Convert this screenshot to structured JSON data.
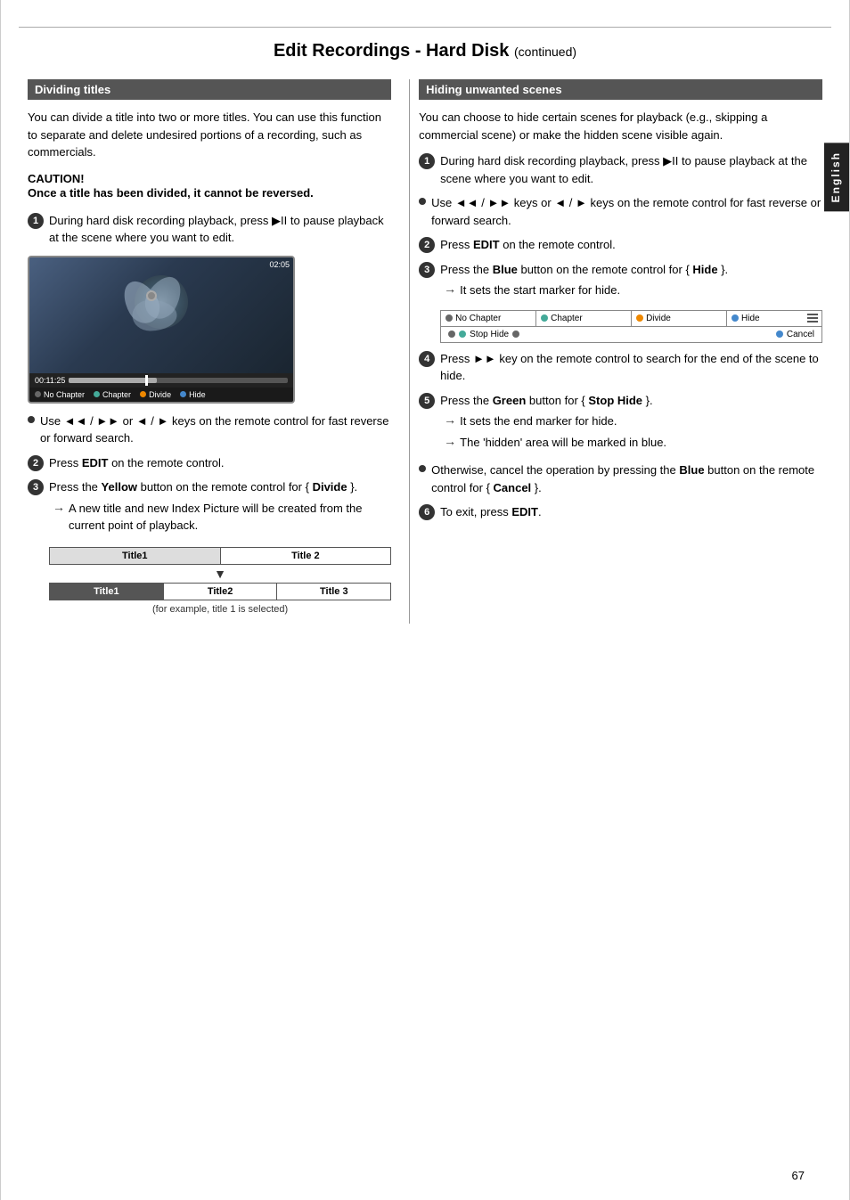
{
  "page": {
    "title": "Edit Recordings - Hard Disk",
    "title_suffix": "(continued)",
    "page_number": "67",
    "side_tab": "English"
  },
  "left_section": {
    "header": "Dividing titles",
    "intro": "You can divide a title into two or more titles. You can use this function to separate and delete undesired portions of a recording, such as commercials.",
    "caution_title": "CAUTION!",
    "caution_body": "Once a title has been divided, it cannot be reversed.",
    "step1": "During hard disk recording playback, press ▶II to pause playback at the scene where you want to edit.",
    "tv_time": "00:11:25",
    "tv_end_time": "02:05",
    "legend_items": [
      {
        "label": "No Chapter",
        "color": "dot-gray"
      },
      {
        "label": "Chapter",
        "color": "dot-green"
      },
      {
        "label": "Divide",
        "color": "dot-orange"
      },
      {
        "label": "Hide",
        "color": "dot-blue"
      }
    ],
    "bullet1": "Use ◄◄ / ►► or ◄ / ► keys on the remote control for fast reverse or forward search.",
    "step2_text": "Press ",
    "step2_bold": "EDIT",
    "step2_rest": " on the remote control.",
    "step3_text": "Press the ",
    "step3_bold": "Yellow",
    "step3_rest": " button on the remote control for { ",
    "step3_bold2": "Divide",
    "step3_rest2": " }.",
    "arrow_note": "A new title and new Index Picture will be created from the current point of playback.",
    "title_diagram": {
      "top_left": "Title1",
      "top_right": "Title 2",
      "bottom_left": "Title1",
      "bottom_mid": "Title2",
      "bottom_right": "Title 3"
    },
    "for_example": "(for example, title 1 is selected)"
  },
  "right_section": {
    "header": "Hiding unwanted scenes",
    "intro": "You can choose to hide certain scenes for playback (e.g., skipping a commercial scene) or make the hidden scene visible again.",
    "step1": "During hard disk recording playback, press ▶II to pause playback at the scene where you want to edit.",
    "bullet1": "Use ◄◄ / ►► keys or ◄ / ► keys on the remote control for fast reverse or forward search.",
    "step2_text": "Press ",
    "step2_bold": "EDIT",
    "step2_rest": " on the remote control.",
    "step3_text": "Press the ",
    "step3_bold": "Blue",
    "step3_rest": " button on the remote control for { ",
    "step3_bold2": "Hide",
    "step3_rest2": " }.",
    "arrow_note1": "It sets the start marker for hide.",
    "hide_diagram": {
      "cols": [
        {
          "label": "No Chapter",
          "color": "dot-gray"
        },
        {
          "label": "Chapter",
          "color": "dot-green"
        },
        {
          "label": "Divide",
          "color": "dot-orange"
        },
        {
          "label": "Hide",
          "color": "dot-blue"
        }
      ],
      "bottom_dot_color": "dot-gray",
      "stop_hide_label": "Stop Hide",
      "stop_hide_color": "dot-green",
      "cancel_label": "Cancel",
      "cancel_color": "dot-blue"
    },
    "step4_text": "Press ►► key on the remote control to search for the end of the scene to hide.",
    "step5_text": "Press the ",
    "step5_bold": "Green",
    "step5_rest": " button for { ",
    "step5_bold2": "Stop Hide",
    "step5_rest2": " }.",
    "arrow_note2": "It sets the end marker for hide.",
    "arrow_note3": "The 'hidden' area will be marked in blue.",
    "bullet2_text": "Otherwise, cancel the operation by pressing the ",
    "bullet2_bold": "Blue",
    "bullet2_rest": " button on the remote control for { ",
    "bullet2_bold2": "Cancel",
    "bullet2_rest2": " }.",
    "step6_text": "To exit, press ",
    "step6_bold": "EDIT",
    "step6_rest": "."
  }
}
